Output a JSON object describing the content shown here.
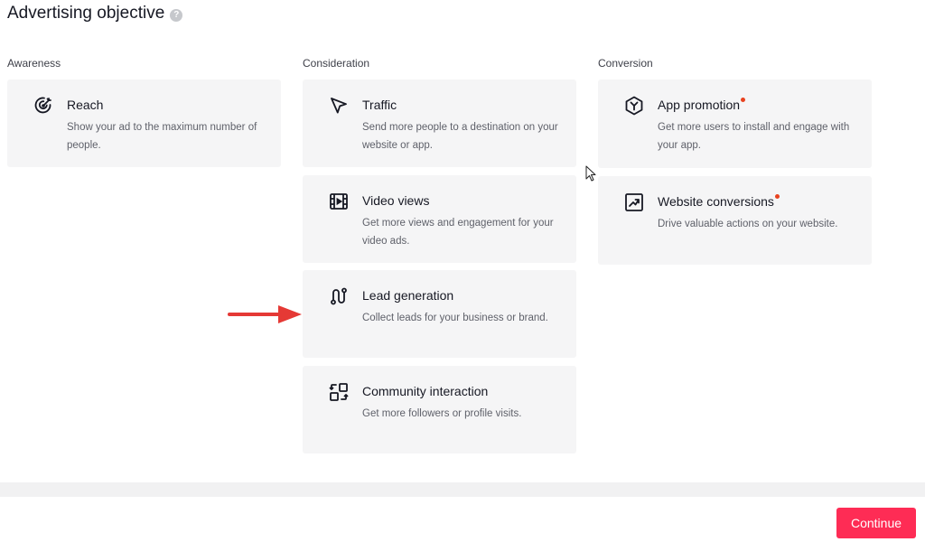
{
  "header": {
    "title": "Advertising objective",
    "help_icon": "?"
  },
  "columns": {
    "awareness": {
      "label": "Awareness"
    },
    "consideration": {
      "label": "Consideration"
    },
    "conversion": {
      "label": "Conversion"
    }
  },
  "cards": {
    "reach": {
      "title": "Reach",
      "desc": "Show your ad to the maximum number of people.",
      "icon": "target-icon"
    },
    "traffic": {
      "title": "Traffic",
      "desc": "Send more people to a destination on your website or app.",
      "icon": "cursor-arrow-icon"
    },
    "video_views": {
      "title": "Video views",
      "desc": "Get more views and engagement for your video ads.",
      "icon": "film-icon"
    },
    "lead_generation": {
      "title": "Lead generation",
      "desc": "Collect leads for your business or brand.",
      "icon": "funnel-path-icon"
    },
    "community_interaction": {
      "title": "Community interaction",
      "desc": "Get more followers or profile visits.",
      "icon": "swap-profile-icon"
    },
    "app_promotion": {
      "title": "App promotion",
      "desc": "Get more users to install and engage with your app.",
      "icon": "hexagon-app-icon",
      "new": true
    },
    "website_conversions": {
      "title": "Website conversions",
      "desc": "Drive valuable actions on your website.",
      "icon": "trend-up-icon",
      "new": true
    }
  },
  "footer": {
    "continue_label": "Continue"
  },
  "colors": {
    "accent": "#fe2c55",
    "card_bg": "#f5f5f6",
    "new_dot": "#e8421f",
    "annotation_arrow": "#e53935"
  }
}
